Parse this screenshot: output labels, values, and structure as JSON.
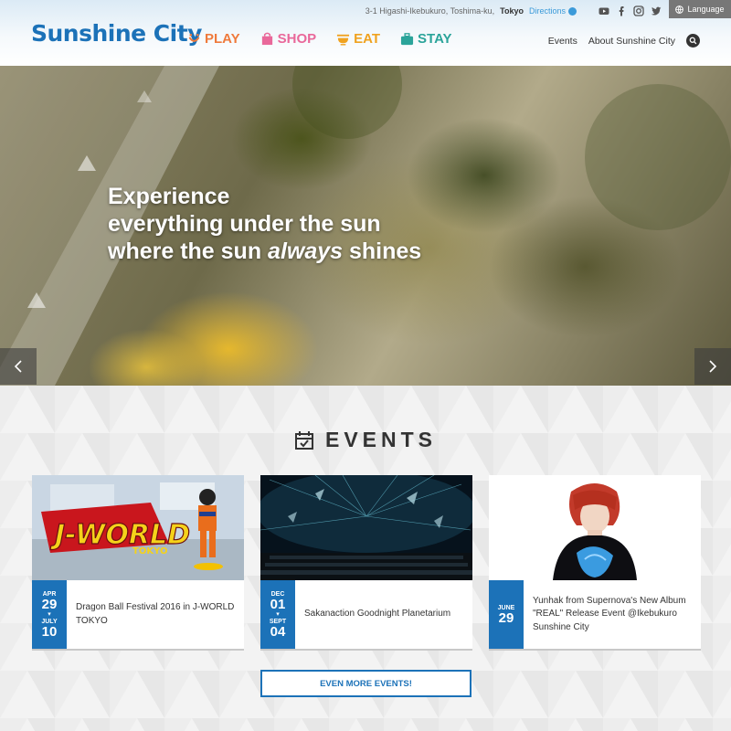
{
  "header": {
    "logo": "Sunshine City",
    "address_prefix": "3-1 Higashi-Ikebukuro, Toshima-ku,",
    "address_city": "Tokyo",
    "directions": "Directions",
    "language": "Language",
    "nav": [
      {
        "label": "PLAY",
        "icon": "smile-icon",
        "color": "#ef7a3c"
      },
      {
        "label": "SHOP",
        "icon": "shopping-bag-icon",
        "color": "#e9689a"
      },
      {
        "label": "EAT",
        "icon": "bowl-icon",
        "color": "#f0a21f"
      },
      {
        "label": "STAY",
        "icon": "suitcase-icon",
        "color": "#2ba49a"
      }
    ],
    "subnav": {
      "events": "Events",
      "about": "About Sunshine City"
    },
    "socials": [
      "youtube-icon",
      "facebook-icon",
      "instagram-icon",
      "twitter-icon"
    ]
  },
  "hero": {
    "line1": "Experience",
    "line2": "everything under the sun",
    "line3_pre": "where the sun ",
    "line3_em": "always",
    "line3_post": " shines"
  },
  "events": {
    "title": "EVENTS",
    "more_label": "EVEN MORE EVENTS!",
    "items": [
      {
        "title": "Dragon Ball Festival 2016 in J-WORLD TOKYO",
        "start_month": "APR",
        "start_day": "29",
        "end_month": "JULY",
        "end_day": "10",
        "image_text": "J-WORLD",
        "image_sub": "TOKYO"
      },
      {
        "title": "Sakanaction Goodnight Planetarium",
        "start_month": "DEC",
        "start_day": "01",
        "end_month": "SEPT",
        "end_day": "04"
      },
      {
        "title": "Yunhak from Supernova's New Album \"REAL\" Release Event @Ikebukuro Sunshine City",
        "start_month": "JUNE",
        "start_day": "29"
      }
    ]
  },
  "colors": {
    "brand": "#1c72b8",
    "date_badge": "#1c72b8"
  }
}
